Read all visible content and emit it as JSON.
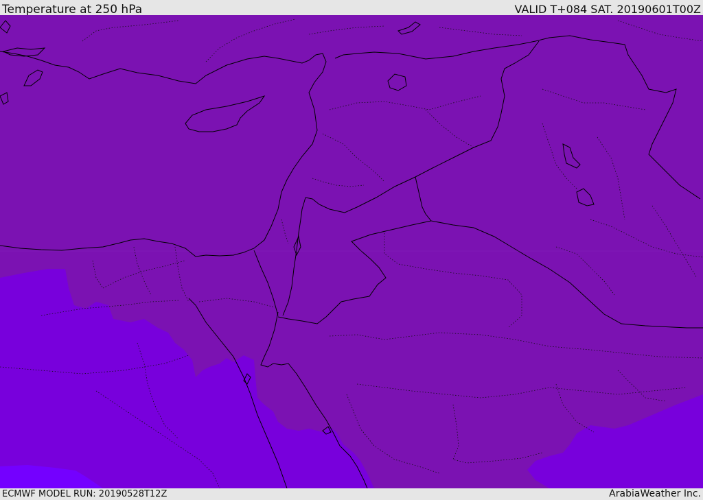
{
  "header": {
    "title": "Temperature at 250 hPa",
    "valid": "VALID T+084 SAT. 20190601T00Z"
  },
  "footer": {
    "model_run": "ECMWF MODEL RUN: 20190528T12Z",
    "credit": "ArabiaWeather Inc."
  },
  "map": {
    "field": "Temperature at 250 hPa",
    "palette": {
      "dark_band": "#7b12b2",
      "mid_band": "#7800dc",
      "light_band": "#7400ff",
      "border": "#000000"
    }
  }
}
